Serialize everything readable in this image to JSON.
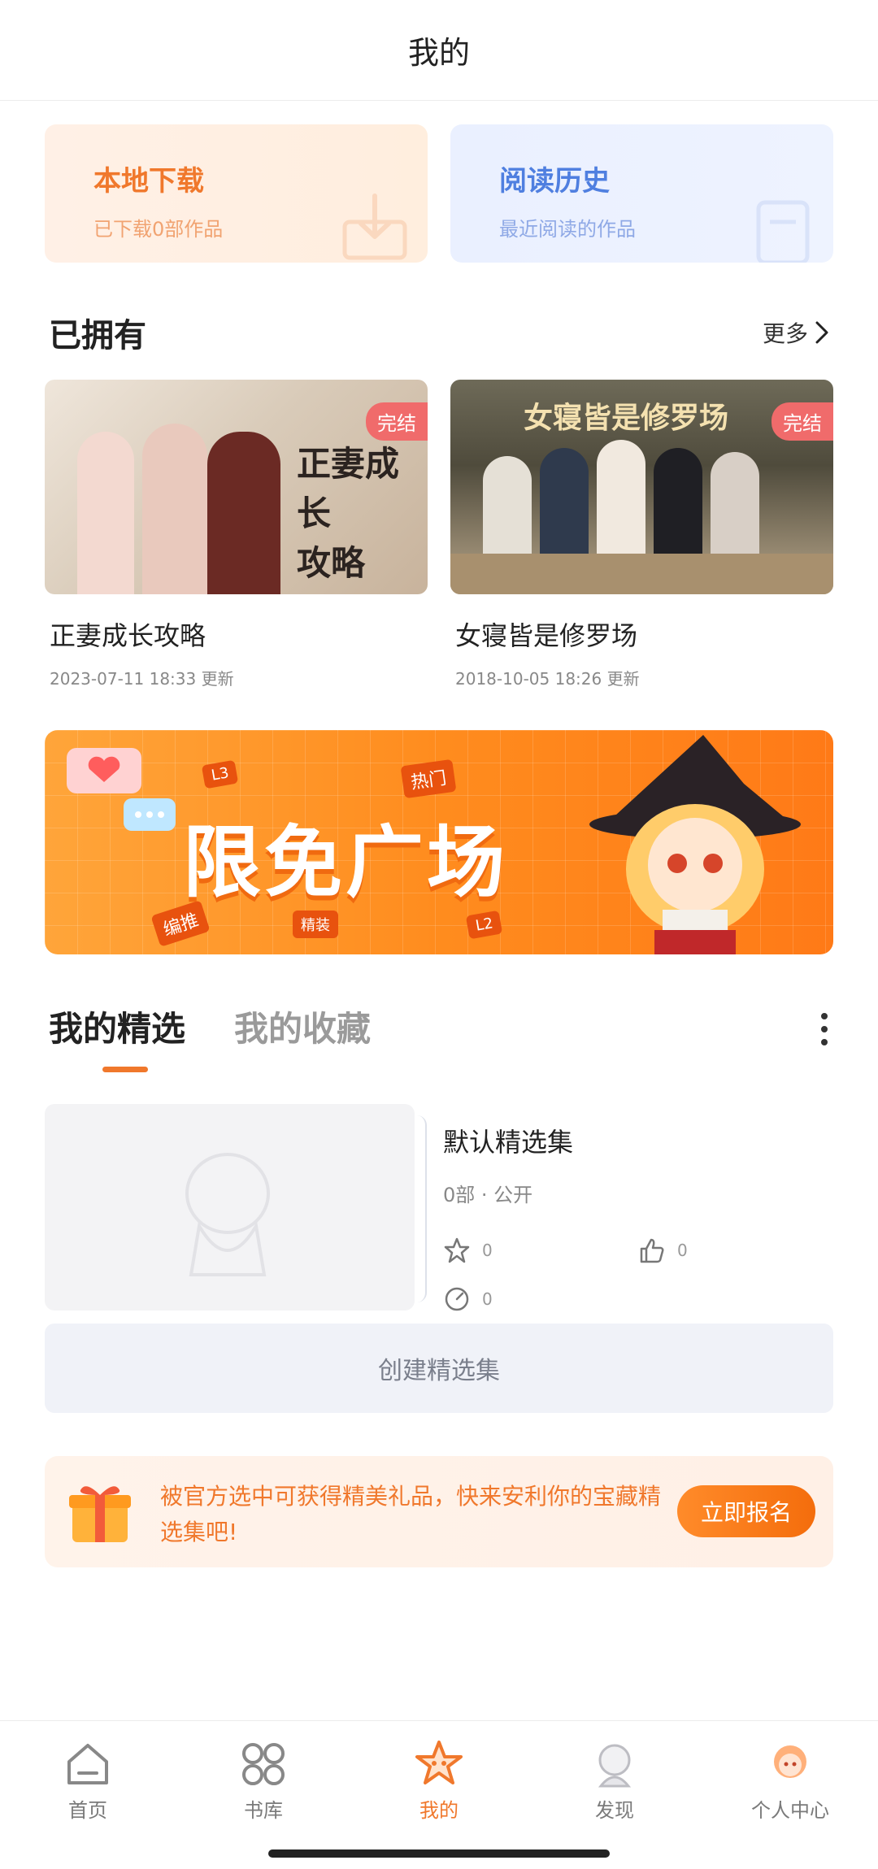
{
  "header": {
    "title": "我的"
  },
  "quick": {
    "download": {
      "title": "本地下载",
      "subtitle": "已下载0部作品"
    },
    "history": {
      "title": "阅读历史",
      "subtitle": "最近阅读的作品"
    }
  },
  "owned": {
    "title": "已拥有",
    "more": "更多",
    "items": [
      {
        "name": "正妻成长攻略",
        "time": "2023-07-11 18:33  更新",
        "badge": "完结"
      },
      {
        "name": "女寝皆是修罗场",
        "time": "2018-10-05 18:26  更新",
        "badge": "完结"
      }
    ]
  },
  "banner": {
    "text": "限免广场",
    "tags": [
      "L3",
      "热门",
      "编推",
      "精装",
      "L2"
    ]
  },
  "tabs": {
    "active": "我的精选",
    "inactive": "我的收藏"
  },
  "collection": {
    "name": "默认精选集",
    "meta": "0部 · 公开",
    "stars": "0",
    "likes": "0",
    "views": "0"
  },
  "create_button": "创建精选集",
  "promo": {
    "text": "被官方选中可获得精美礼品，快来安利你的宝藏精选集吧!",
    "button": "立即报名"
  },
  "tabbar": {
    "items": [
      {
        "label": "首页"
      },
      {
        "label": "书库"
      },
      {
        "label": "我的"
      },
      {
        "label": "发现"
      },
      {
        "label": "个人中心"
      }
    ]
  },
  "colors": {
    "accent": "#f0782c",
    "badge": "#f06b6b"
  }
}
